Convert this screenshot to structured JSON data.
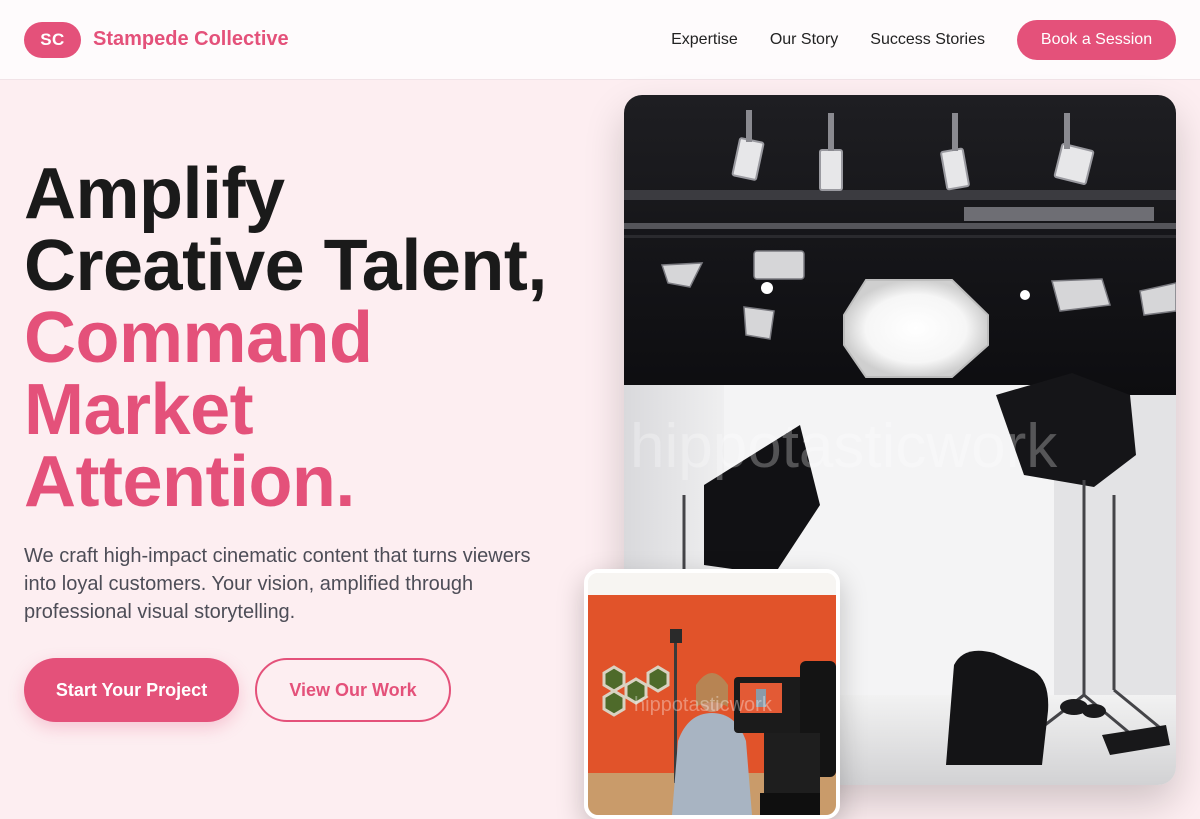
{
  "header": {
    "logo_initials": "SC",
    "brand_name": "Stampede Collective",
    "nav": [
      {
        "label": "Expertise"
      },
      {
        "label": "Our Story"
      },
      {
        "label": "Success Stories"
      }
    ],
    "cta_label": "Book a Session"
  },
  "hero": {
    "headline_line1": "Amplify",
    "headline_line2": "Creative Talent,",
    "headline_accent1": "Command",
    "headline_accent2": "Market",
    "headline_accent3": "Attention.",
    "subtext": "We craft high-impact cinematic content that turns viewers into loyal customers. Your vision, amplified through professional visual storytelling.",
    "primary_cta": "Start Your Project",
    "secondary_cta": "View Our Work"
  },
  "images": {
    "main_watermark": "hippotasticwork",
    "small_watermark": "hippotasticwork"
  },
  "colors": {
    "accent": "#e4517a",
    "background": "#fdeef1",
    "text_dark": "#1a1a1a",
    "text_muted": "#4d4d57"
  }
}
